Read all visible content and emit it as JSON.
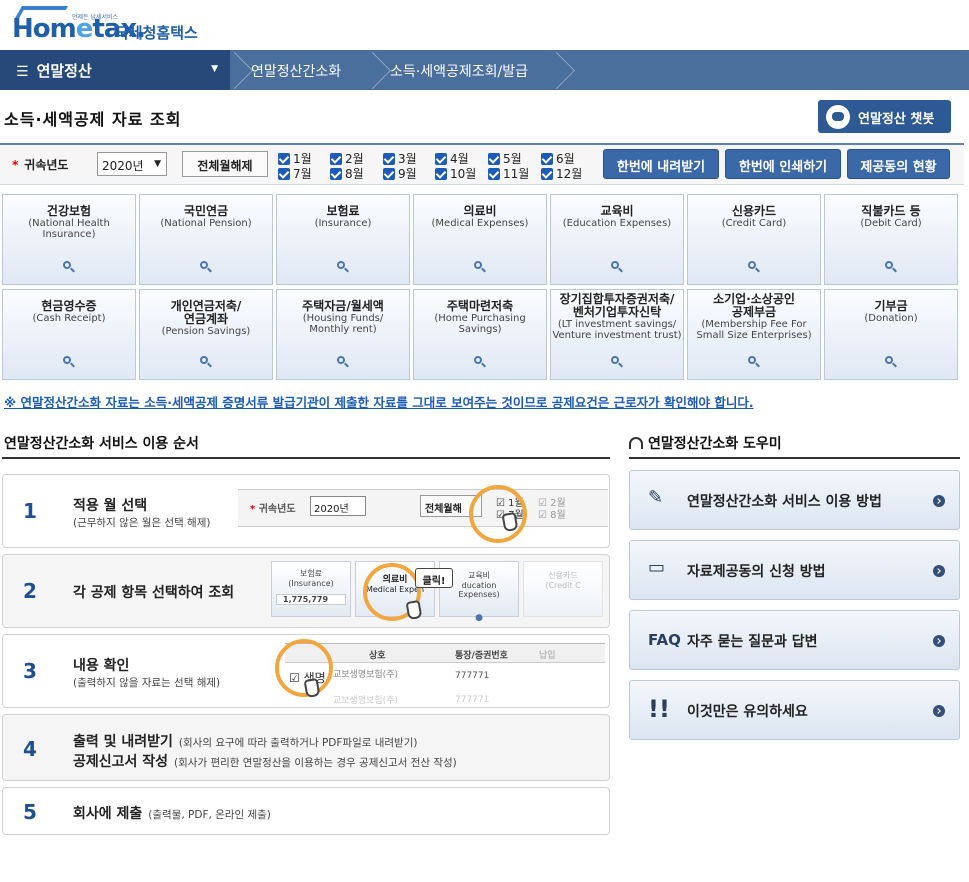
{
  "logo": {
    "small": "언제든 납세서비스",
    "main_a": "Hom",
    "main_e": "e",
    "main_b": "tax.",
    "korean": "국세청홈택스"
  },
  "nav": {
    "main": "연말정산",
    "crumbs": [
      "연말정산간소화",
      "소득·세액공제조회/발급"
    ]
  },
  "page_title": "소득·세액공제 자료 조회",
  "chatbot_label": "연말정산 챗봇",
  "filter": {
    "year_label": "귀속년도",
    "year_value": "2020년",
    "deselect_all": "전체월해제",
    "months": [
      "1월",
      "2월",
      "3월",
      "4월",
      "5월",
      "6월",
      "7월",
      "8월",
      "9월",
      "10월",
      "11월",
      "12월"
    ],
    "buttons": [
      "한번에 내려받기",
      "한번에 인쇄하기",
      "제공동의 현황"
    ]
  },
  "tiles_row1": [
    {
      "title": "건강보험",
      "sub1": "(National Health",
      "sub2": "Insurance)"
    },
    {
      "title": "국민연금",
      "sub1": "(National Pension)",
      "sub2": ""
    },
    {
      "title": "보험료",
      "sub1": "(Insurance)",
      "sub2": ""
    },
    {
      "title": "의료비",
      "sub1": "(Medical Expenses)",
      "sub2": ""
    },
    {
      "title": "교육비",
      "sub1": "(Education Expenses)",
      "sub2": ""
    },
    {
      "title": "신용카드",
      "sub1": "(Credit Card)",
      "sub2": ""
    },
    {
      "title": "직불카드 등",
      "sub1": "(Debit Card)",
      "sub2": ""
    }
  ],
  "tiles_row2": [
    {
      "title": "현금영수증",
      "title2": "",
      "sub1": "(Cash Receipt)",
      "sub2": ""
    },
    {
      "title": "개인연금저축/",
      "title2": "연금계좌",
      "sub1": "(Pension Savings)",
      "sub2": ""
    },
    {
      "title": "주택자금/월세액",
      "title2": "",
      "sub1": "(Housing Funds/",
      "sub2": "Monthly rent)"
    },
    {
      "title": "주택마련저축",
      "title2": "",
      "sub1": "(Home Purchasing Savings)",
      "sub2": ""
    },
    {
      "title": "장기집합투자증권저축/",
      "title2": "벤처기업투자신탁",
      "sub1": "(LT investment savings/",
      "sub2": "Venture investment trust)"
    },
    {
      "title": "소기업·소상공인",
      "title2": "공제부금",
      "sub1": "(Membership Fee For",
      "sub2": "Small Size Enterprises)"
    },
    {
      "title": "기부금",
      "title2": "",
      "sub1": "(Donation)",
      "sub2": ""
    }
  ],
  "notice": "※ 연말정산간소화 자료는 소득·세액공제 증명서류 발급기관이 제출한 자료를 그대로 보여주는 것이므로 공제요건은 근로자가 확인해야 합니다.",
  "steps_title": "연말정산간소화 서비스 이용 순서",
  "steps": [
    {
      "num": "1",
      "main": "적용 월 선택",
      "sub": "(근무하지 않은 월은 선택 해제)"
    },
    {
      "num": "2",
      "main": "각 공제 항목 선택하여 조회",
      "sub": ""
    },
    {
      "num": "3",
      "main": "내용 확인",
      "sub": "(출력하지 않을 자료는 선택 해제)"
    },
    {
      "num": "4",
      "main": "출력 및 내려받기",
      "main_note": "(회사의 요구에 따라 출력하거나 PDF파일로 내려받기)",
      "main2": "공제신고서 작성",
      "main2_note": "(회사가 편리한 연말정산을 이용하는 경우 공제신고서 전산 작성)"
    },
    {
      "num": "5",
      "main": "회사에 제출",
      "main_note": "(출력물, PDF, 온라인 제출)"
    }
  ],
  "illus": {
    "s1_year_label": "귀속년도",
    "s1_year_value": "2020년",
    "s1_deselect": "전체월해",
    "s1_m1": "1월",
    "s1_m7": "7월",
    "s1_m2": "2월",
    "s1_m8": "8월",
    "s2_t1": "보험료",
    "s2_t1s": "(Insurance)",
    "s2_value": "1,775,779",
    "s2_t2": "의료비",
    "s2_t2s": "Medical Expen",
    "s2_t3": "교육비",
    "s2_t3s": "ducation Expenses)",
    "s2_t4": "신용카드",
    "s2_t4s": "(Credit C",
    "s2_click": "클릭!",
    "s3_h1": "상호",
    "s3_h2": "통장/증권번호",
    "s3_h3": "납입",
    "s3_r1": "생명",
    "s3_r1b": "교보생명보험(주)",
    "s3_r1c": "777771",
    "s3_r2": "교보생명보험(주)",
    "s3_r2c": "777771"
  },
  "helper_title": "연말정산간소화 도우미",
  "helpers": [
    {
      "icon": "document-pen-icon",
      "label": "연말정산간소화 서비스 이용 방법"
    },
    {
      "icon": "document-icon",
      "label": "자료제공동의 신청 방법"
    },
    {
      "icon": "faq-icon",
      "label": "자주 묻는 질문과 답변",
      "icon_text": "FAQ"
    },
    {
      "icon": "exclamation-icon",
      "label": "이것만은 유의하세요"
    }
  ]
}
